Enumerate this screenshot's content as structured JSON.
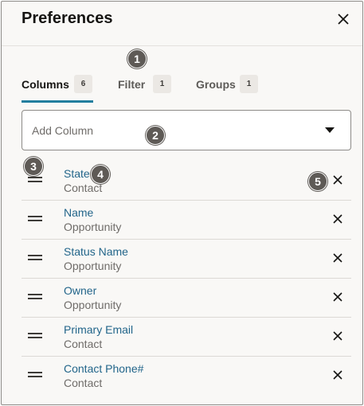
{
  "header": {
    "title": "Preferences"
  },
  "tabs": [
    {
      "label": "Columns",
      "count": "6",
      "active": true
    },
    {
      "label": "Filter",
      "count": "1",
      "active": false
    },
    {
      "label": "Groups",
      "count": "1",
      "active": false
    }
  ],
  "add_column": {
    "placeholder": "Add Column"
  },
  "columns": [
    {
      "name": "State",
      "source": "Contact"
    },
    {
      "name": "Name",
      "source": "Opportunity"
    },
    {
      "name": "Status Name",
      "source": "Opportunity"
    },
    {
      "name": "Owner",
      "source": "Opportunity"
    },
    {
      "name": "Primary Email",
      "source": "Contact"
    },
    {
      "name": "Contact Phone#",
      "source": "Contact"
    }
  ],
  "callouts": [
    "1",
    "2",
    "3",
    "4",
    "5"
  ],
  "colors": {
    "accent": "#227e9e",
    "link": "#22658a",
    "callout": "#5e5a56"
  },
  "icons": {
    "close": "close-icon",
    "drag": "drag-handle-icon",
    "dropdown": "chevron-down-icon",
    "remove": "close-icon"
  }
}
